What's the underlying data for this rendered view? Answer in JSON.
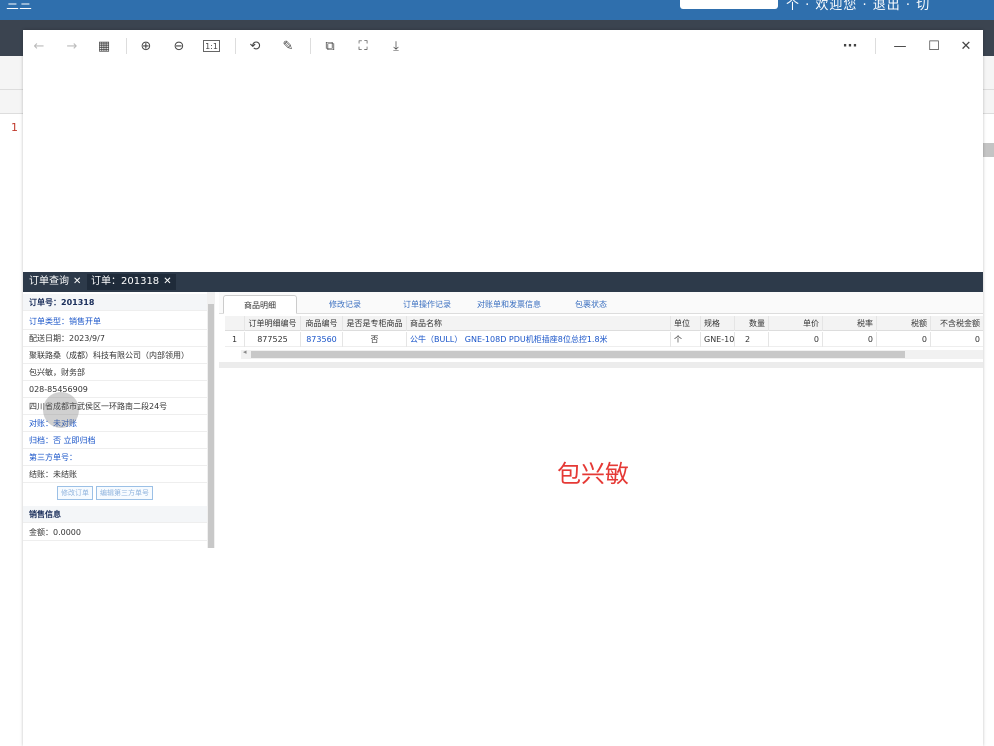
{
  "top_bar": {
    "left_text": "三三",
    "right_text": "个 · 欢迎您 · 退出 · 切"
  },
  "background": {
    "row_number": "1"
  },
  "viewer": {
    "toolbar": {
      "back": "←",
      "forward": "→",
      "grid": "▦",
      "zoom_in": "⊕",
      "zoom_out": "⊖",
      "actual_size": "1:1",
      "rotate": "⟲",
      "edit": "✎",
      "copy": "⧉",
      "crop": "⛶",
      "download": "⤓",
      "more": "···",
      "minimize": "—",
      "maximize": "☐",
      "close": "✕"
    }
  },
  "app": {
    "tabs": [
      {
        "label": "订单查询",
        "close": "✕"
      },
      {
        "label": "订单：201318",
        "close": "✕"
      }
    ],
    "left_panel": {
      "title": "订单号：201318",
      "rows": [
        "订单类型：销售开单",
        "配送日期：2023/9/7",
        "聚联路桑（成都）科技有限公司（内部领用）",
        "包兴敏，财务部",
        "028-85456909",
        "四川省成都市武侯区一环路南二段24号",
        "对账：未对账",
        "归档：否 立即归档",
        "第三方单号：",
        "结账：未结账"
      ],
      "buttons": [
        "修改订单",
        "编辑第三方单号"
      ],
      "section_title": "销售信息",
      "amount": "金额：0.0000"
    },
    "right_panel": {
      "subtabs": [
        "商品明细",
        "修改记录",
        "订单操作记录",
        "对账单和发票信息",
        "包裹状态"
      ],
      "columns": [
        "订单明细编号",
        "商品编号",
        "是否是专柜商品",
        "商品名称",
        "单位",
        "规格",
        "数量",
        "单价",
        "税率",
        "税额",
        "不含税金额"
      ],
      "rows": [
        {
          "index": "1",
          "detail_id": "877525",
          "product_id": "873560",
          "counter": "否",
          "name": "公牛（BULL） GNE-108D PDU机柜插座8位总控1.8米",
          "unit": "个",
          "spec": "GNE-10",
          "qty": "2",
          "price": "0",
          "tax_rate": "0",
          "tax": "0",
          "amount": "0"
        }
      ],
      "scroll_left": "◂"
    },
    "watermark": "包兴敏"
  }
}
